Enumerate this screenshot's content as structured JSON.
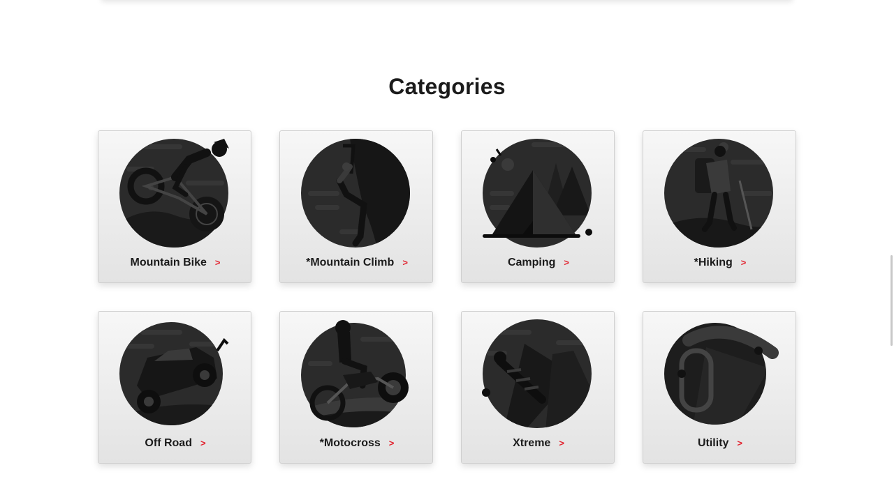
{
  "section": {
    "title": "Categories"
  },
  "categories": [
    {
      "label": "Mountain Bike",
      "icon": "mountain-bike-icon"
    },
    {
      "label": "*Mountain Climb",
      "icon": "mountain-climb-icon"
    },
    {
      "label": "Camping",
      "icon": "camping-icon"
    },
    {
      "label": "*Hiking",
      "icon": "hiking-icon"
    },
    {
      "label": "Off Road",
      "icon": "off-road-icon"
    },
    {
      "label": "*Motocross",
      "icon": "motocross-icon"
    },
    {
      "label": "Xtreme",
      "icon": "xtreme-icon"
    },
    {
      "label": "Utility",
      "icon": "utility-icon"
    }
  ],
  "chevron": ">",
  "colors": {
    "accent": "#e2232f",
    "text": "#1b1b1b",
    "illustration_dark": "#1c1c1c",
    "illustration_mid": "#2e2e2e",
    "illustration_light": "#3a3a3a"
  }
}
